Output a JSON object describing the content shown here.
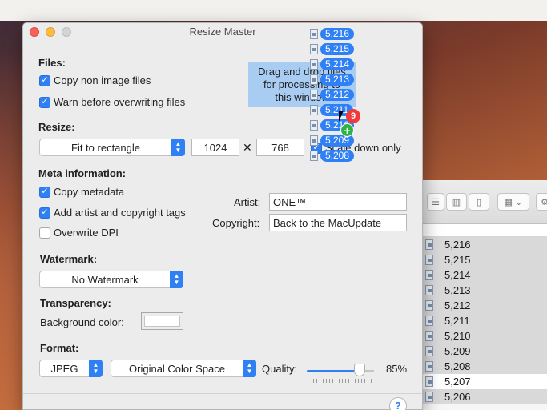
{
  "window": {
    "title": "Resize Master"
  },
  "files": {
    "heading": "Files:",
    "copy_non_image": {
      "label": "Copy non image files",
      "checked": true
    },
    "warn_overwrite": {
      "label": "Warn before overwriting files",
      "checked": true
    }
  },
  "resize": {
    "heading": "Resize:",
    "mode": "Fit to rectangle",
    "width": "1024",
    "times": "✕",
    "height": "768",
    "scale_down_label": "Scale down only",
    "scale_down_checked": true
  },
  "meta": {
    "heading": "Meta information:",
    "copy_metadata": {
      "label": "Copy metadata",
      "checked": true
    },
    "add_artist": {
      "label": "Add artist and copyright tags",
      "checked": true
    },
    "overwrite_dpi": {
      "label": "Overwrite DPI",
      "checked": false
    },
    "artist_label": "Artist:",
    "artist_value": "ONE™",
    "copyright_label": "Copyright:",
    "copyright_value": "Back to the MacUpdate"
  },
  "watermark": {
    "heading": "Watermark:",
    "value": "No Watermark"
  },
  "transparency": {
    "heading": "Transparency:",
    "bg_label": "Background color:",
    "bg_color": "#ffffff"
  },
  "format": {
    "heading": "Format:",
    "type": "JPEG",
    "color_space": "Original Color Space",
    "quality_label": "Quality:",
    "quality_value": "85%",
    "quality": 0.85
  },
  "dropzone": {
    "line1": "Drag and drop files",
    "line2": "for processing to",
    "line3": "this window"
  },
  "drag": {
    "items": [
      "5,216",
      "5,215",
      "5,214",
      "5,213",
      "5,212",
      "5,211",
      "5,210",
      "5,209",
      "5,208"
    ],
    "count": "9",
    "plus": "+"
  },
  "finder": {
    "rows": [
      "5,216",
      "5,215",
      "5,214",
      "5,213",
      "5,212",
      "5,211",
      "5,210",
      "5,209",
      "5,208",
      "5,207",
      "5,206"
    ]
  },
  "help": "?",
  "colors": {
    "accent": "#2f7ff5",
    "badge": "#f23a3a",
    "plus": "#2fb344"
  }
}
